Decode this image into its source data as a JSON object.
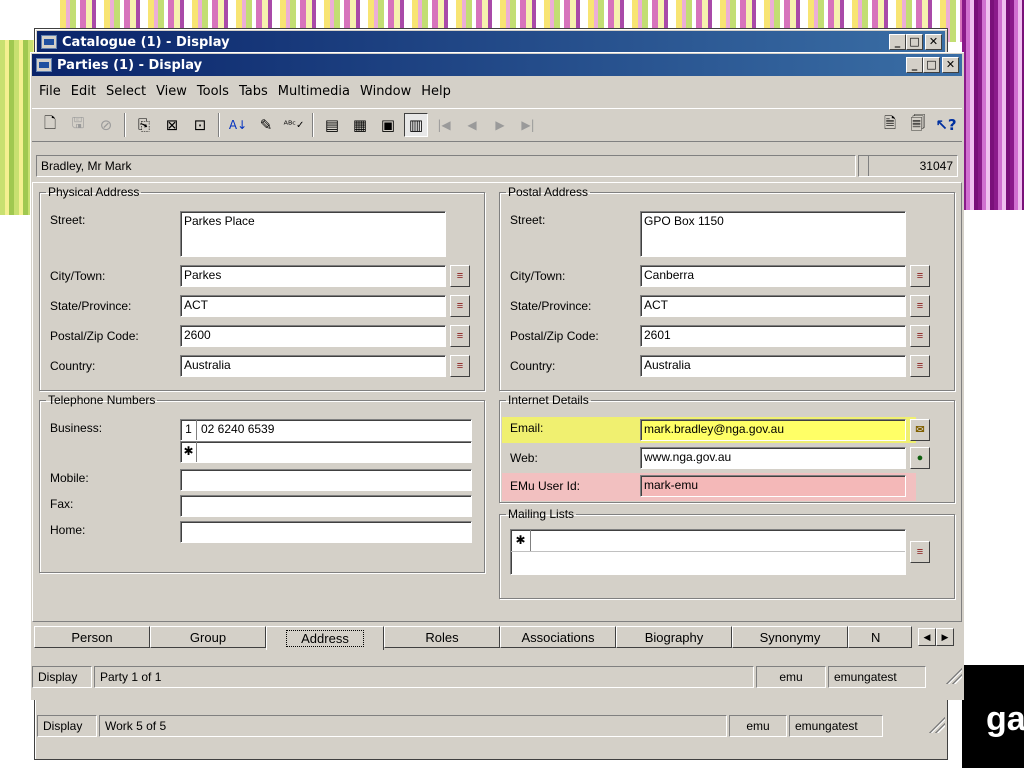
{
  "back_window": {
    "title": "Catalogue (1) - Display",
    "status": {
      "mode": "Display",
      "record": "Work 5 of 5",
      "user": "emu",
      "db": "emungatest"
    }
  },
  "main_window": {
    "title": "Parties (1) - Display",
    "menu": [
      "File",
      "Edit",
      "Select",
      "View",
      "Tools",
      "Tabs",
      "Multimedia",
      "Window",
      "Help"
    ],
    "record_name": "Bradley, Mr Mark",
    "record_id": "31047",
    "physical_address": {
      "legend": "Physical Address",
      "street_label": "Street:",
      "street": "Parkes Place",
      "city_label": "City/Town:",
      "city": "Parkes",
      "state_label": "State/Province:",
      "state": "ACT",
      "postal_label": "Postal/Zip Code:",
      "postal": "2600",
      "country_label": "Country:",
      "country": "Australia"
    },
    "postal_address": {
      "legend": "Postal Address",
      "street_label": "Street:",
      "street": "GPO Box 1150",
      "city_label": "City/Town:",
      "city": "Canberra",
      "state_label": "State/Province:",
      "state": "ACT",
      "postal_label": "Postal/Zip Code:",
      "postal": "2601",
      "country_label": "Country:",
      "country": "Australia"
    },
    "telephone": {
      "legend": "Telephone Numbers",
      "business_label": "Business:",
      "business_index": "1",
      "business": "02 6240 6539",
      "new_row_marker": "✱",
      "mobile_label": "Mobile:",
      "mobile": "",
      "fax_label": "Fax:",
      "fax": "",
      "home_label": "Home:",
      "home": ""
    },
    "internet": {
      "legend": "Internet Details",
      "email_label": "Email:",
      "email": "mark.bradley@nga.gov.au",
      "web_label": "Web:",
      "web": "www.nga.gov.au",
      "user_label": "EMu User Id:",
      "user_id": "mark-emu"
    },
    "mailing": {
      "legend": "Mailing Lists",
      "new_row_marker": "✱"
    },
    "tabs": [
      "Person",
      "Group",
      "Address",
      "Roles",
      "Associations",
      "Biography",
      "Synonymy",
      "N"
    ],
    "active_tab": "Address",
    "status": {
      "mode": "Display",
      "record": "Party 1 of 1",
      "user": "emu",
      "db": "emungatest"
    }
  },
  "colors": {
    "email_highlight": "#ffff66",
    "user_highlight": "#f4b8b8",
    "title_start": "#0a246a",
    "title_end": "#3a6ea5"
  }
}
